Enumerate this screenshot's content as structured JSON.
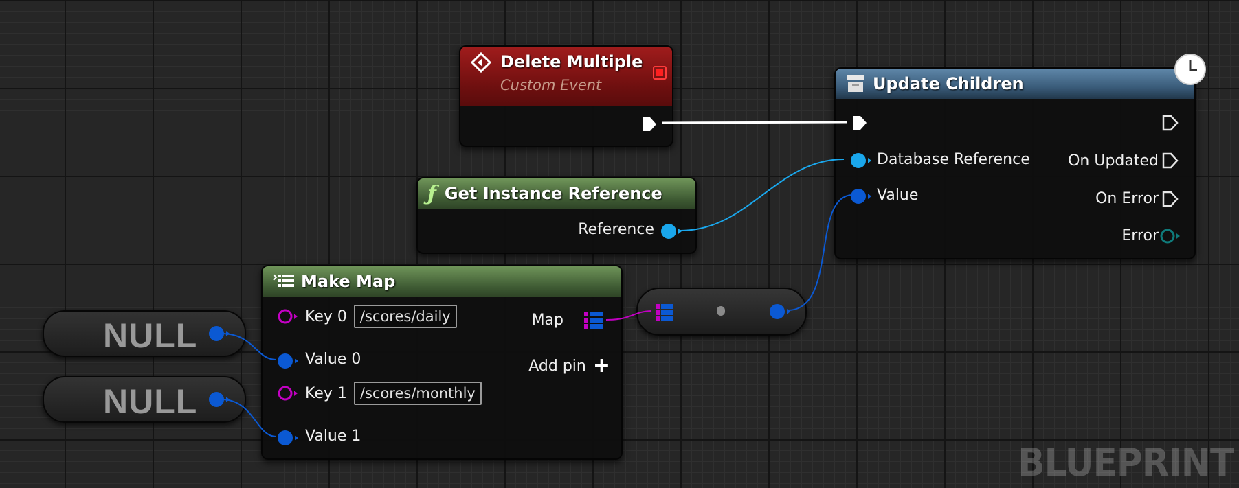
{
  "colors": {
    "event_header": "#8b1616",
    "function_header": "#4e6e3e",
    "async_header": "#3f6281",
    "exec_pin": "#ffffff",
    "structure_pin": "#1aa7ec",
    "wildcard_pin": "#0b59d3",
    "string_pin": "#c300c3",
    "error_pin": "#0f6e6e"
  },
  "nodes": {
    "delete_multiple": {
      "title": "Delete Multiple",
      "subtitle": "Custom Event",
      "icon": "event-diamond-icon"
    },
    "get_instance_reference": {
      "title": "Get Instance Reference",
      "icon": "function-icon",
      "output": "Reference"
    },
    "update_children": {
      "title": "Update Children",
      "icon": "database-icon",
      "inputs": {
        "database_reference": "Database Reference",
        "value": "Value"
      },
      "outputs": {
        "on_updated": "On Updated",
        "on_error": "On Error",
        "error": "Error"
      }
    },
    "make_map": {
      "title": "Make Map",
      "icon": "map-icon",
      "key0_label": "Key 0",
      "key0_value": "/scores/daily",
      "value0_label": "Value 0",
      "key1_label": "Key 1",
      "key1_value": "/scores/monthly",
      "value1_label": "Value 1",
      "map_output": "Map",
      "add_pin": "Add pin"
    },
    "null_1": {
      "label": "NULL"
    },
    "null_2": {
      "label": "NULL"
    }
  },
  "watermark": "BLUEPRINT"
}
